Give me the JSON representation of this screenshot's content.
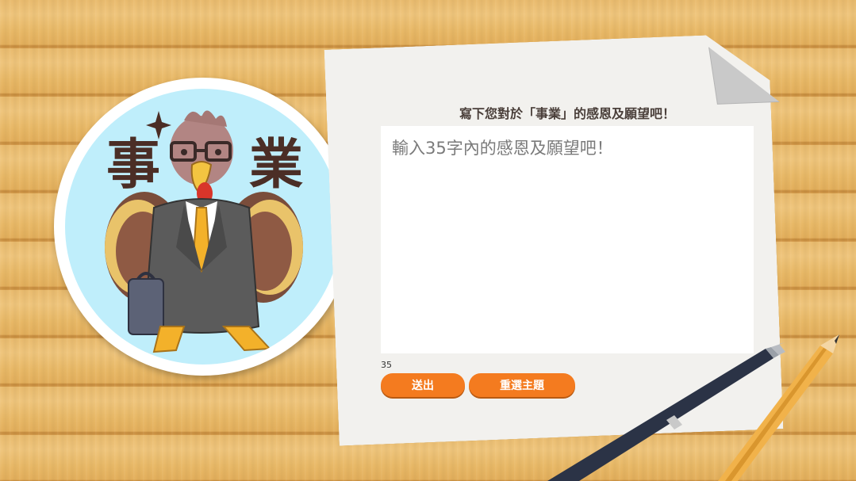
{
  "sticker": {
    "char_left": "事",
    "char_right": "業"
  },
  "card": {
    "title": "寫下您對於「事業」的感恩及願望吧！",
    "input_placeholder": "輸入35字內的感恩及願望吧！",
    "input_value": "",
    "char_limit": "35",
    "submit_label": "送出",
    "reselect_label": "重選主題"
  },
  "colors": {
    "accent": "#f47b1f",
    "sticker_bg": "#bfeefb",
    "paper": "#f2f1ee"
  },
  "icons": [
    "turkey-mascot-illustration",
    "sparkle-icon",
    "pen-icon",
    "pencil-icon"
  ]
}
